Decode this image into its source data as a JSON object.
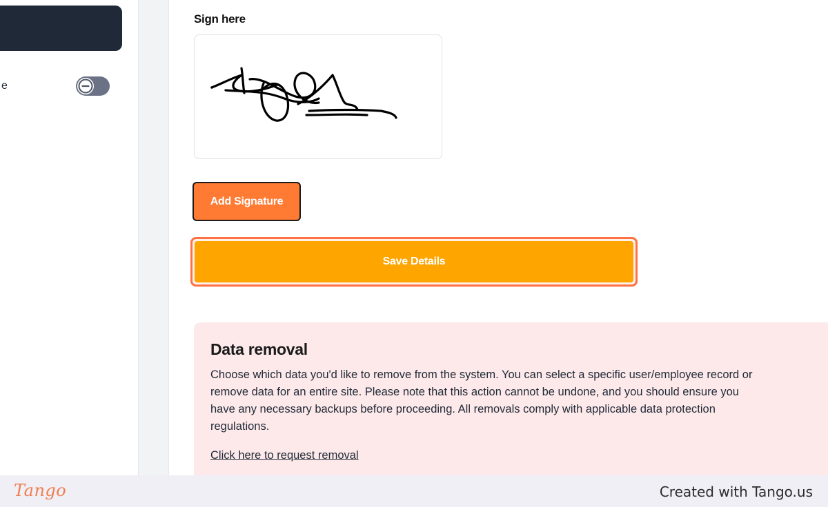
{
  "sidebar": {
    "row_text": "e",
    "toggle_state": "off"
  },
  "signature": {
    "label": "Sign here",
    "add_button": "Add Signature"
  },
  "actions": {
    "save_button": "Save Details"
  },
  "data_removal": {
    "title": "Data removal",
    "description": "Choose which data you'd like to remove from the system. You can select a specific user/employee record or remove data for an entire site. Please note that this action cannot be undone, and you should ensure you have any necessary backups before proceeding. All removals comply with applicable data protection regulations.",
    "link": "Click here to request removal"
  },
  "footer": {
    "logo": "Tango",
    "credit": "Created with Tango.us"
  },
  "colors": {
    "sidebar_dark": "#1f2937",
    "add_signature_bg": "#ff7a33",
    "save_bg": "#ffa500",
    "save_highlight": "#ff7043",
    "removal_bg": "#fde9e9",
    "tango_orange": "#f07d50"
  },
  "icons": {
    "toggle": "toggle-minus-icon",
    "signature": "handwritten-signature"
  }
}
